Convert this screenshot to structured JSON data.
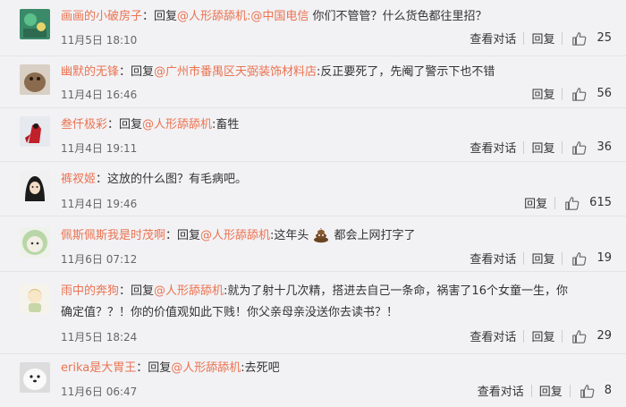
{
  "comments": [
    {
      "user": "画画的小破房子",
      "prefix": "：回复",
      "mention": "@人形舔舔机:@中国电信",
      "text": " 你们不管管？什么货色都往里招？",
      "date": "11月5日 18:10",
      "view_label": "查看对话",
      "reply_label": "回复",
      "likes": "25"
    },
    {
      "user": "幽默的无锋",
      "prefix": "：回复",
      "mention": "@广州市番禺区天弼装饰材料店",
      "text": ":反正要死了，先阉了警示下也不错",
      "date": "11月4日 16:46",
      "reply_label": "回复",
      "likes": "56"
    },
    {
      "user": "叁仟极彩",
      "prefix": "：回复",
      "mention": "@人形舔舔机",
      "text": ":畜牲",
      "date": "11月4日 19:11",
      "view_label": "查看对话",
      "reply_label": "回复",
      "likes": "36"
    },
    {
      "user": "裤衩姬",
      "prefix": "：这放的什么图？有毛病吧。",
      "date": "11月4日 19:46",
      "reply_label": "回复",
      "likes": "615"
    },
    {
      "user": "佩斯佩斯我是时茂啊",
      "prefix": "：回复",
      "mention": "@人形舔舔机",
      "text": ":这年头",
      "text2": "都会上网打字了",
      "emoji": "poop-emoji",
      "date": "11月6日 07:12",
      "view_label": "查看对话",
      "reply_label": "回复",
      "likes": "19"
    },
    {
      "user": "雨中的奔狗",
      "prefix": "：回复",
      "mention": "@人形舔舔机",
      "text": ":就为了射十几次精，搭进去自己一条命，祸害了16个女童一生，你",
      "text_line2": "确定值？？！你的价值观如此下贱！你父亲母亲没送你去读书？！",
      "date": "11月5日 18:24",
      "view_label": "查看对话",
      "reply_label": "回复",
      "likes": "29"
    },
    {
      "user": "erika是大胃王",
      "prefix": "：回复",
      "mention": "@人形舔舔机",
      "text": ":去死吧",
      "date": "11月6日 06:47",
      "view_label": "查看对话",
      "reply_label": "回复",
      "likes": "8"
    }
  ]
}
